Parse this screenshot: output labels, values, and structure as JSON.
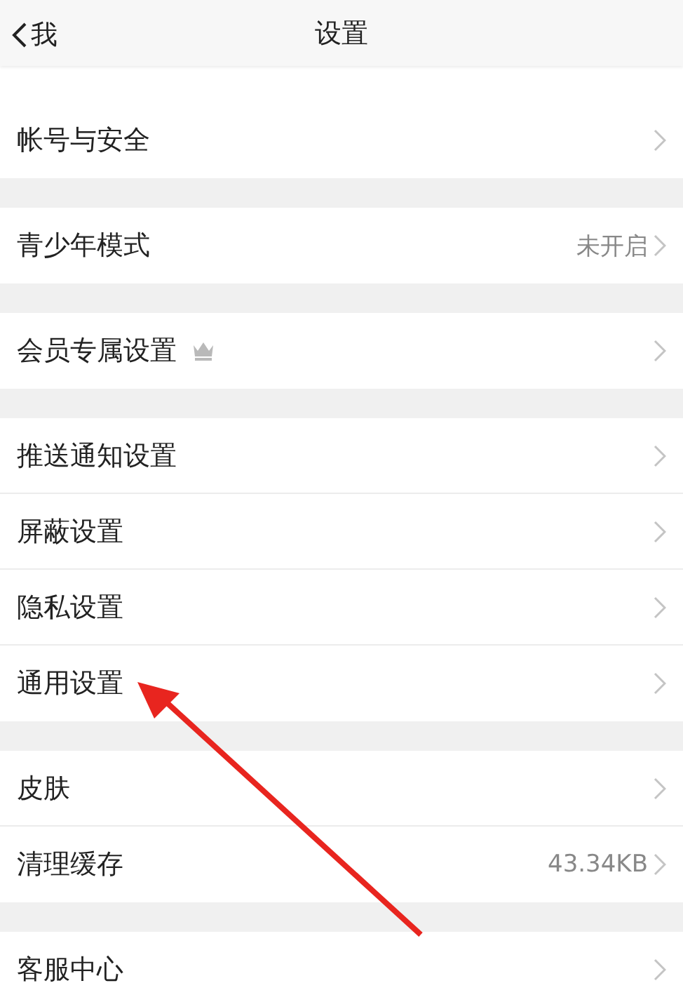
{
  "nav": {
    "back": "我",
    "title": "设置"
  },
  "groups": [
    {
      "rows": [
        {
          "label": "帐号与安全",
          "kind": "plain"
        }
      ]
    },
    {
      "rows": [
        {
          "label": "青少年模式",
          "kind": "plain",
          "value": "未开启"
        }
      ]
    },
    {
      "rows": [
        {
          "label": "会员专属设置",
          "kind": "crown"
        }
      ]
    },
    {
      "rows": [
        {
          "label": "推送通知设置",
          "kind": "plain"
        },
        {
          "label": "屏蔽设置",
          "kind": "plain"
        },
        {
          "label": "隐私设置",
          "kind": "plain"
        },
        {
          "label": "通用设置",
          "kind": "plain"
        }
      ]
    },
    {
      "rows": [
        {
          "label": "皮肤",
          "kind": "plain"
        },
        {
          "label": "清理缓存",
          "kind": "plain",
          "value": "43.34KB"
        }
      ]
    },
    {
      "rows": [
        {
          "label": "客服中心",
          "kind": "plain"
        }
      ]
    }
  ]
}
